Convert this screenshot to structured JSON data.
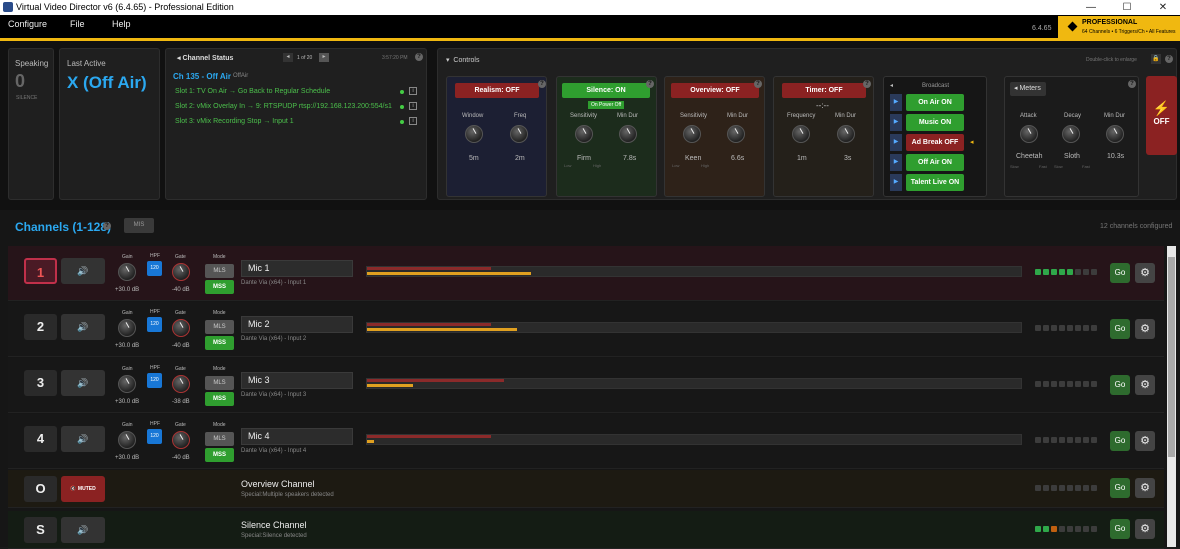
{
  "window": {
    "title": "Virtual Video Director v6 (6.4.65) - Professional Edition",
    "min": "—",
    "max": "☐",
    "close": "✕"
  },
  "menu": [
    "Configure",
    "File",
    "Help"
  ],
  "version": "6.4.65",
  "pro": {
    "title": "PROFESSIONAL",
    "sub": "64 Channels • 6 Triggers/Ch • All Features"
  },
  "speaking": {
    "label": "Speaking",
    "value": "0",
    "state": "SILENCE"
  },
  "lastActive": {
    "label": "Last Active",
    "value": "X (Off Air)"
  },
  "channelStatus": {
    "title": "Channel Status",
    "page": "1 of 20",
    "time": "3:57:20 PM",
    "header": "Ch 135 - Off Air",
    "headerTag": "OffAir",
    "slots": [
      "Slot 1: TV On Air → Go Back to Regular Schedule",
      "Slot 2: vMix Overlay In → 9: RTSPUDP  rtsp://192.168.123.200:554/s1",
      "Slot 3: vMix Recording Stop → Input 1"
    ]
  },
  "controls": {
    "title": "Controls",
    "hint": "Double-click to enlarge",
    "realism": {
      "head": "Realism: OFF",
      "k1": "Window",
      "k2": "Freq",
      "v1": "5m",
      "v2": "2m"
    },
    "silence": {
      "head": "Silence: ON",
      "sub": "On Power Off",
      "k1": "Sensitivity",
      "k2": "Min Dur",
      "v1": "Firm",
      "v2": "7.8s",
      "lo": "Low",
      "hi": "High"
    },
    "overview": {
      "head": "Overview: OFF",
      "k1": "Sensitivity",
      "k2": "Min Dur",
      "v1": "Keen",
      "v2": "6.6s",
      "lo": "Low",
      "hi": "High"
    },
    "timer": {
      "head": "Timer: OFF",
      "time": "--:--",
      "k1": "Frequency",
      "k2": "Min Dur",
      "v1": "1m",
      "v2": "3s"
    },
    "broadcast": {
      "title": "Broadcast",
      "buttons": [
        "On Air ON",
        "Music ON",
        "Ad Break OFF",
        "Off Air ON",
        "Talent Live ON"
      ]
    },
    "meters": {
      "title": "Meters",
      "k1": "Attack",
      "k2": "Decay",
      "k3": "Min Dur",
      "v1": "Cheetah",
      "v2": "Sloth",
      "v3": "10.3s",
      "s1": "Slow",
      "f1": "Fast",
      "s2": "Slow",
      "f2": "Fast"
    },
    "offLabel": "OFF"
  },
  "channelsHeader": {
    "title": "Channels (1-128)",
    "msBtn": "MIS",
    "count": "12 channels configured"
  },
  "labels": {
    "gain": "Gain",
    "hpf": "HPF",
    "gate": "Gate",
    "mode": "Mode",
    "hpfVal": "120",
    "mls": "MLS",
    "mss": "MSS",
    "go": "Go"
  },
  "channels": [
    {
      "num": "1",
      "name": "Mic 1",
      "source": "Dante Via (x64) - Input 1",
      "gain": "+30.0 dB",
      "gate": "-40 dB",
      "red": 0.19,
      "yel": 0.25,
      "leds": 5
    },
    {
      "num": "2",
      "name": "Mic 2",
      "source": "Dante Via (x64) - Input 2",
      "gain": "+30.0 dB",
      "gate": "-40 dB",
      "red": 0.19,
      "yel": 0.23,
      "leds": 0
    },
    {
      "num": "3",
      "name": "Mic 3",
      "source": "Dante Via (x64) - Input 3",
      "gain": "+30.0 dB",
      "gate": "-38 dB",
      "red": 0.21,
      "yel": 0.07,
      "leds": 0
    },
    {
      "num": "4",
      "name": "Mic 4",
      "source": "Dante Via (x64) - Input 4",
      "gain": "+30.0 dB",
      "gate": "-40 dB",
      "red": 0.19,
      "yel": 0.01,
      "leds": 0
    }
  ],
  "special": [
    {
      "num": "O",
      "btn": "MUTED",
      "name": "Overview Channel",
      "sub": "Special:Multiple speakers detected"
    },
    {
      "num": "S",
      "btn": "",
      "name": "Silence Channel",
      "sub": "Special:Silence detected"
    }
  ],
  "colors": {
    "accent": "#f0b810",
    "green": "#2f9e2f",
    "red": "#8b2222",
    "blue": "#1877d6"
  }
}
